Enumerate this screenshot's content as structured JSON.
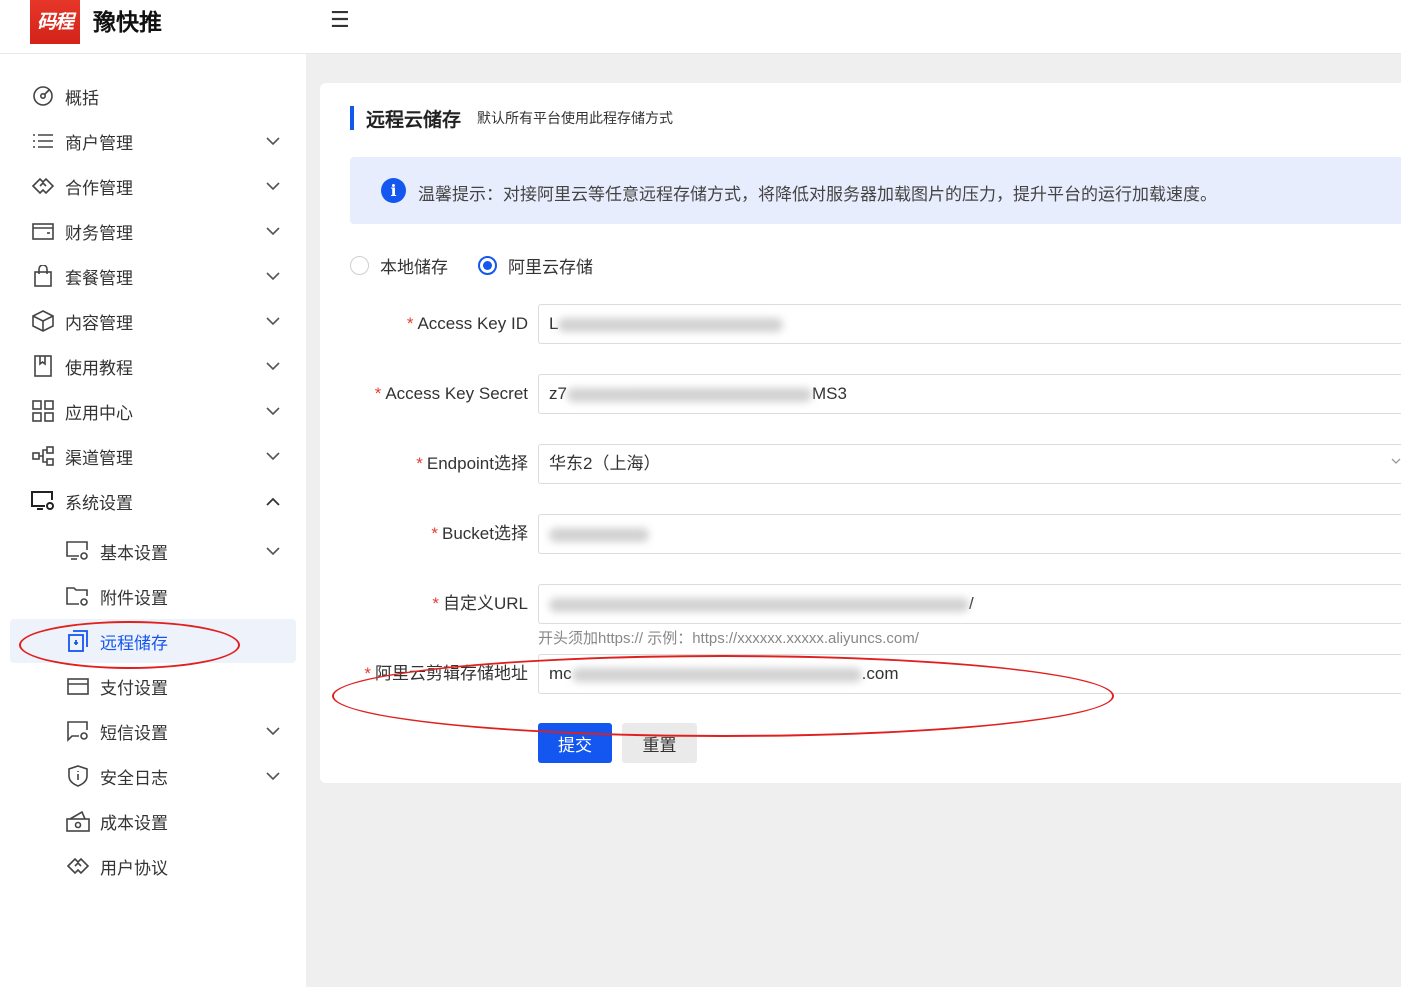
{
  "header": {
    "logo_text": "码程",
    "brand": "豫快推",
    "menu_toggle": "☰"
  },
  "sidebar": {
    "items": [
      {
        "label": "概括",
        "icon": "dashboard-icon"
      },
      {
        "label": "商户管理",
        "icon": "list-icon"
      },
      {
        "label": "合作管理",
        "icon": "handshake-icon"
      },
      {
        "label": "财务管理",
        "icon": "wallet-icon"
      },
      {
        "label": "套餐管理",
        "icon": "bag-icon"
      },
      {
        "label": "内容管理",
        "icon": "cube-icon"
      },
      {
        "label": "使用教程",
        "icon": "book-icon"
      },
      {
        "label": "应用中心",
        "icon": "apps-icon"
      },
      {
        "label": "渠道管理",
        "icon": "channel-icon"
      },
      {
        "label": "系统设置",
        "icon": "system-settings-icon"
      }
    ],
    "subitems": [
      {
        "label": "基本设置",
        "icon": "monitor-gear-icon"
      },
      {
        "label": "附件设置",
        "icon": "folder-gear-icon"
      },
      {
        "label": "远程储存",
        "icon": "remote-storage-icon"
      },
      {
        "label": "支付设置",
        "icon": "payment-icon"
      },
      {
        "label": "短信设置",
        "icon": "sms-icon"
      },
      {
        "label": "安全日志",
        "icon": "shield-icon"
      },
      {
        "label": "成本设置",
        "icon": "cost-icon"
      },
      {
        "label": "用户协议",
        "icon": "agreement-icon"
      }
    ],
    "active": "远程储存"
  },
  "page": {
    "title": "远程云储存",
    "subtitle": "默认所有平台使用此程存储方式",
    "alert": "温馨提示：对接阿里云等任意远程存储方式，将降低对服务器加载图片的压力，提升平台的运行加载速度。",
    "storage_options": [
      {
        "label": "本地储存",
        "selected": false
      },
      {
        "label": "阿里云存储",
        "selected": true
      }
    ]
  },
  "form": {
    "access_key_id": {
      "label": "Access Key ID",
      "value_prefix": "L",
      "value_suffix": ""
    },
    "access_key_secret": {
      "label": "Access Key Secret",
      "value_prefix": "z7",
      "value_suffix": "MS3"
    },
    "endpoint": {
      "label": "Endpoint选择",
      "value": "华东2（上海）"
    },
    "bucket": {
      "label": "Bucket选择",
      "value_prefix": "",
      "value_suffix": ""
    },
    "custom_url": {
      "label": "自定义URL",
      "value_prefix": "",
      "value_suffix": "/",
      "hint": "开头须加https:// 示例：https://xxxxxx.xxxxx.aliyuncs.com/"
    },
    "crop_storage": {
      "label": "阿里云剪辑存储地址",
      "value_prefix": "mc",
      "value_suffix": ".com"
    },
    "submit": "提交",
    "reset": "重置"
  },
  "colors": {
    "accent": "#1456f0",
    "required": "#e43d33",
    "annotation": "#e0201e",
    "alert_bg": "#e8edfd"
  }
}
